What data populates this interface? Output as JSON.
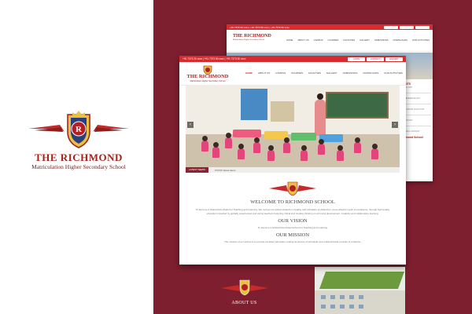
{
  "brand": {
    "title": "THE RICHMOND",
    "subtitle": "Matriculation Higher Secondary School",
    "colors": {
      "maroon": "#7e1f2f",
      "red": "#d62b2f",
      "title_red": "#a8201a"
    }
  },
  "front": {
    "contact": "+91 7373 20 xxxx | +91 7373 50 xxxx | +91 7373 30 xxxx",
    "top_buttons": [
      "LOGIN",
      "CONTACT",
      "ENQUIRY"
    ],
    "logo_title": "THE RICHMOND",
    "logo_sub": "Matriculation Higher Secondary School",
    "nav": [
      "HOME",
      "ABOUT US",
      "CAMPUS",
      "COURSES",
      "FACILITIES",
      "GALLERY",
      "ADMISSIONS",
      "DOWNLOADS",
      "OUR ACTIVITIES"
    ],
    "news_label": "LATEST NEWS",
    "news_text": "XXXXX News Items",
    "welcome_title": "WELCOME TO RICHMOND SCHOOL",
    "welcome_text": "To become a Global Role Model for Teaching and Learning. We nurture our global students in healthy self inclination of distinction, come ahead in spirit of excellence, through high quality education imparted by globally experienced and caring teachers fostering critical and creative thinking on all round development, creativity and collaborative learning.",
    "vision_title": "OUR VISION",
    "vision_text": "To become a Global Role Model School for Teaching and Learning",
    "mission_title": "OUR MISSION",
    "mission_text": "The mission of our school is to provide excellent education making its service of scholastic and extracurricular pursuits of a lifetime."
  },
  "back": {
    "logo_title": "THE RICHMOND",
    "logo_sub": "Matriculation Higher Secondary School",
    "nav": [
      "HOME",
      "ABOUT US",
      "CAMPUS",
      "COURSES",
      "FACILITIES",
      "GALLERY",
      "ADMISSIONS",
      "DOWNLOADS",
      "OUR ACTIVITIES"
    ],
    "side_head": "EVENTS",
    "side_items": [
      "ANNUAL DAY",
      "INDEPENDENCE DAY",
      "GRADUATION FUNCTION",
      "SPORTS DAY",
      "FOOTBALL CRICKET"
    ],
    "side_head2": "Richmond School"
  },
  "about_title": "ABOUT US"
}
